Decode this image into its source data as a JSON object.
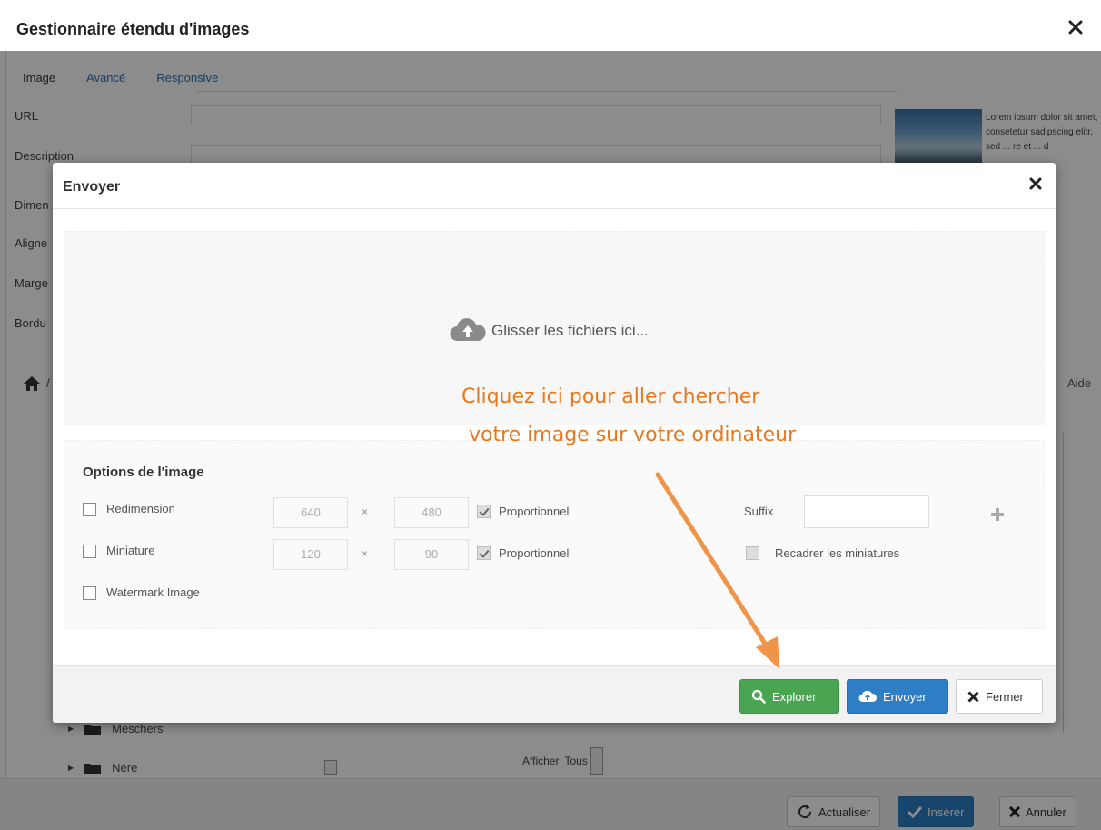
{
  "outer": {
    "title": "Gestionnaire étendu d'images",
    "tabs": [
      "Image",
      "Avancé",
      "Responsive"
    ],
    "fields": [
      "URL",
      "Description",
      "Dimen",
      "Aligne",
      "Marge",
      "Bordu"
    ],
    "preview_text": "Lorem ipsum dolor sit amet, consetetur sadipscing elitr, sed ... re et ... d",
    "aide": "Aide",
    "crumb_sep": "/",
    "tree_items": [
      "Meschers",
      "Nere"
    ],
    "afficher_label": "Afficher",
    "afficher_value": "Tous",
    "footer": {
      "refresh": "Actualiser",
      "insert": "Insérer",
      "cancel": "Annuler"
    }
  },
  "modal": {
    "title": "Envoyer",
    "dropzone_text": "Glisser les fichiers ici...",
    "options_title": "Options de l'image",
    "resize_label": "Redimension",
    "resize_width": "640",
    "resize_height": "480",
    "thumb_label": "Miniature",
    "thumb_width": "120",
    "thumb_height": "90",
    "times": "×",
    "proportional_label": "Proportionnel",
    "watermark_label": "Watermark Image",
    "suffix_label": "Suffix",
    "crop_label": "Recadrer les miniatures",
    "buttons": {
      "explore": "Explorer",
      "send": "Envoyer",
      "close": "Fermer"
    }
  },
  "annotation": {
    "line1": "Cliquez ici pour aller chercher",
    "line2": "votre image sur votre ordinateur",
    "color": "#e8781d"
  },
  "colors": {
    "green": "#4aa552",
    "blue": "#2d7ec4",
    "annotation": "#e8781d"
  }
}
